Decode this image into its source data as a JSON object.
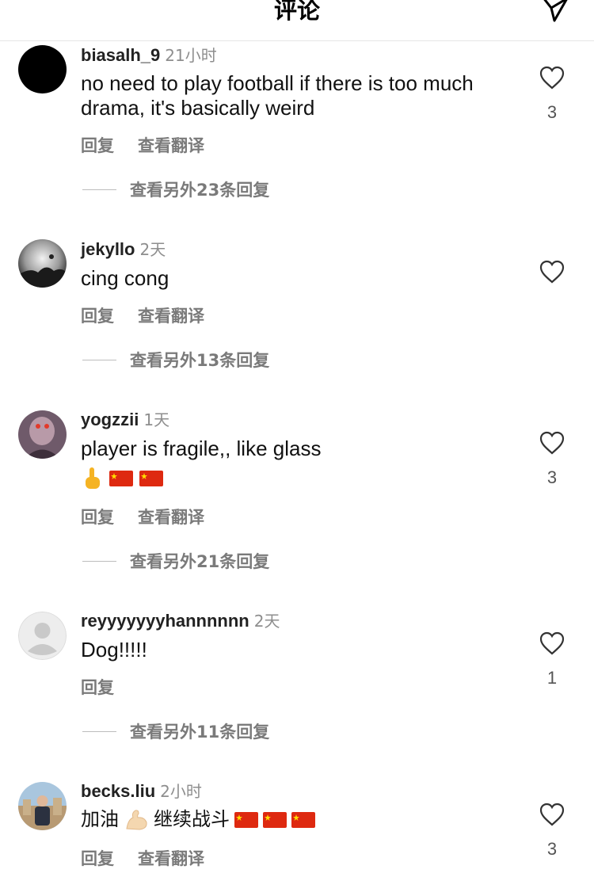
{
  "header": {
    "title": "评论",
    "send_icon": "send-icon"
  },
  "comments": [
    {
      "username": "biasalh_9",
      "time": "21小时",
      "text": "no need to play football if there is too much drama, it's basically weird",
      "reply_label": "回复",
      "translate_label": "查看翻译",
      "view_replies": "查看另外23条回复",
      "like_count": "3"
    },
    {
      "username": "jekyllo",
      "time": "2天",
      "text": "cing cong",
      "reply_label": "回复",
      "translate_label": "查看翻译",
      "view_replies": "查看另外13条回复"
    },
    {
      "username": "yogzzii",
      "time": "1天",
      "text": "player is fragile,, like glass",
      "reply_label": "回复",
      "translate_label": "查看翻译",
      "view_replies": "查看另外21条回复",
      "like_count": "3"
    },
    {
      "username": "reyyyyyyyhannnnnn",
      "time": "2天",
      "text": "Dog!!!!!",
      "reply_label": "回复",
      "view_replies": "查看另外11条回复",
      "like_count": "1"
    },
    {
      "username": "becks.liu",
      "time": "2小时",
      "text_part1": "加油",
      "text_part2": "继续战斗",
      "reply_label": "回复",
      "translate_label": "查看翻译",
      "like_count": "3"
    }
  ],
  "colors": {
    "meta_gray": "#8e8e8e",
    "action_gray": "#7a7a7a",
    "flag_red": "#de2910",
    "flag_star": "#ffde00"
  }
}
